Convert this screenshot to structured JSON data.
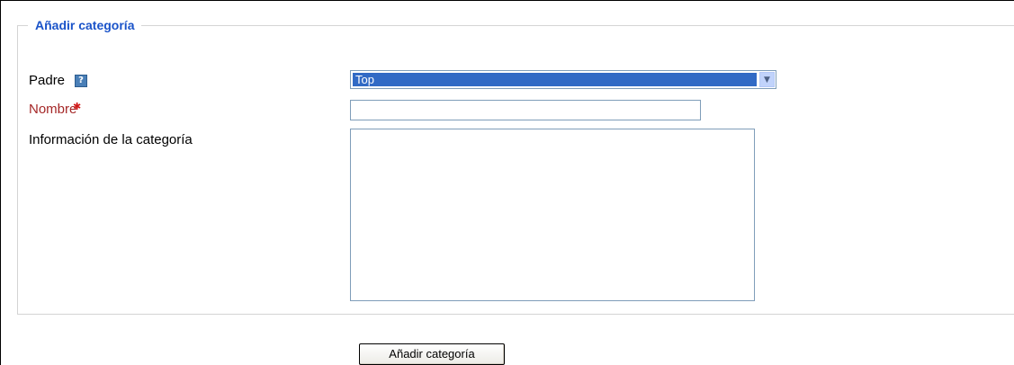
{
  "form": {
    "legend": "Añadir categoría",
    "parent": {
      "label": "Padre",
      "help_icon_glyph": "?",
      "selected_value": "Top"
    },
    "name": {
      "label": "Nombre",
      "required_glyph": "✱",
      "value": ""
    },
    "info": {
      "label": "Información de la categoría",
      "value": ""
    },
    "submit_label": "Añadir categoría"
  },
  "icons": {
    "help": "help-icon",
    "required": "required-icon",
    "dropdown": "chevron-down-icon",
    "scroll_up": "scroll-up-icon",
    "scroll_down": "scroll-down-icon"
  },
  "colors": {
    "legend_text": "#1a53c9",
    "required_label": "#a52828",
    "required_marker": "#d01818",
    "selection_bg": "#316ac5",
    "input_border": "#7f9db9"
  }
}
